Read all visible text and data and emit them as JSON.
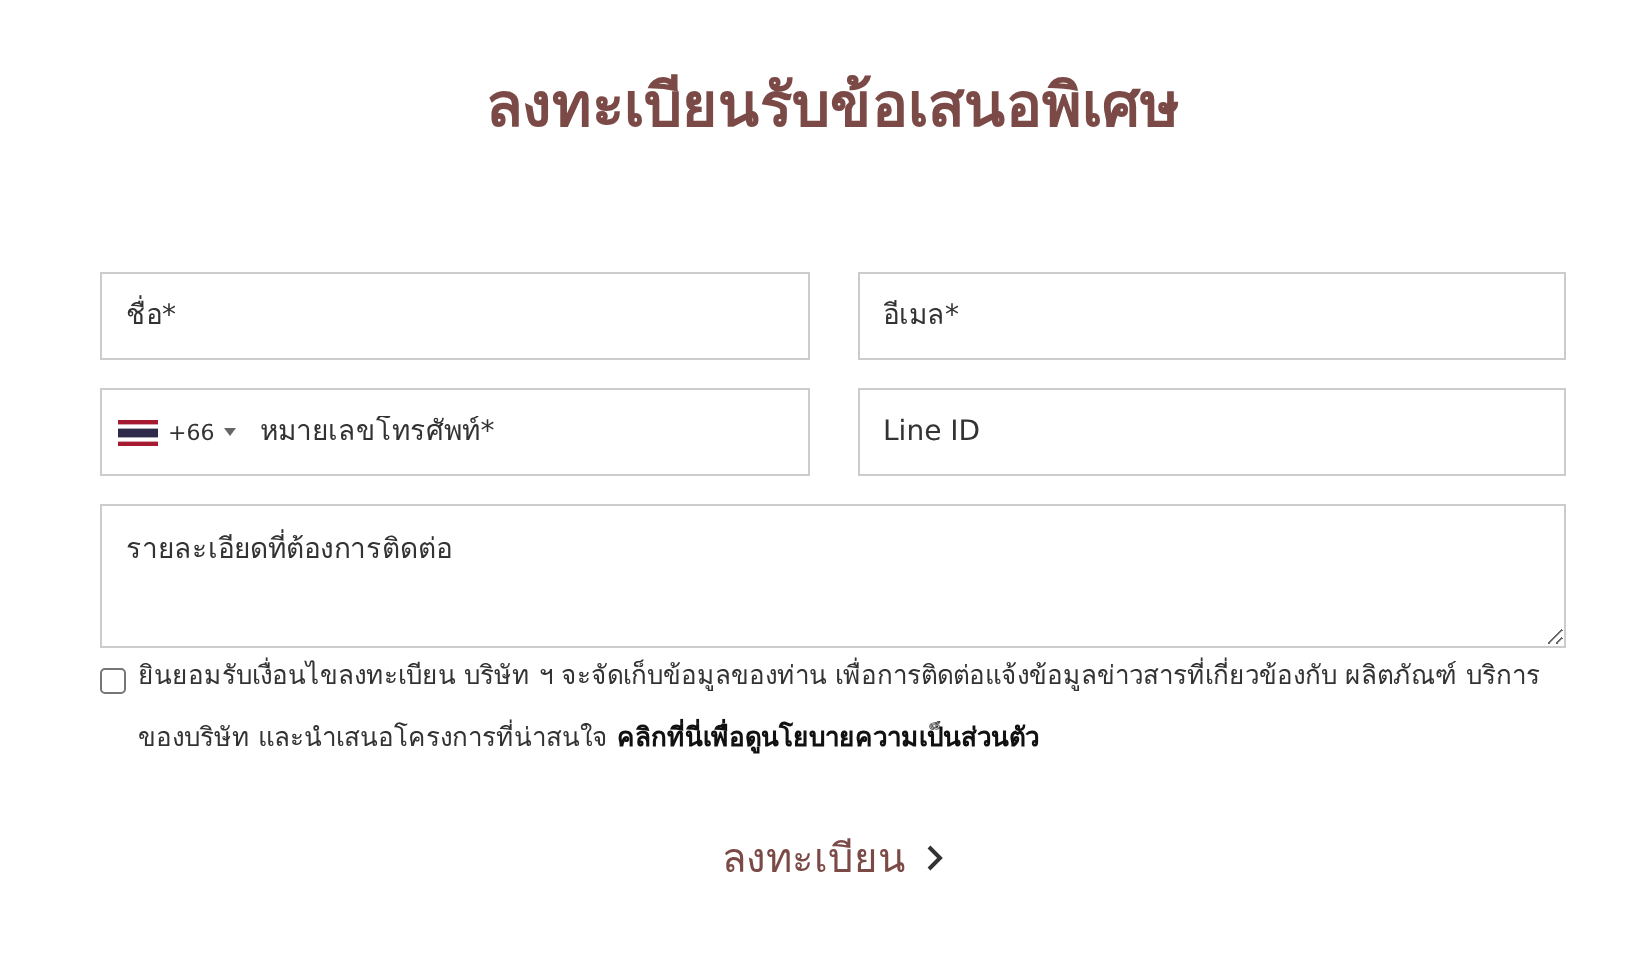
{
  "title": "ลงทะเบียนรับข้อเสนอพิเศษ",
  "fields": [
    {
      "kind": "text",
      "placeholder": "ชื่อ*"
    },
    {
      "kind": "text",
      "placeholder": "อีเมล*"
    },
    {
      "kind": "phone",
      "code": "+66",
      "placeholder": "หมายเลขโทรศัพท์*"
    },
    {
      "kind": "text",
      "placeholder": "Line ID"
    },
    {
      "kind": "textarea",
      "placeholder": "รายละเอียดที่ต้องการติดต่อ"
    }
  ],
  "consent": {
    "checked": false,
    "text": "ยินยอมรับเงื่อนไขลงทะเบียน บริษัท ฯ จะจัดเก็บข้อมูลของท่าน เพื่อการติดต่อแจ้งข้อมูลข่าวสารที่เกี่ยวข้องกับ ผลิตภัณฑ์ บริการของบริษัท และนำเสนอโครงการที่น่าสนใจ",
    "link": "คลิกที่นี่เพื่อดูนโยบายความเป็นส่วนตัว"
  },
  "submit": {
    "label": "ลงทะเบียน"
  }
}
